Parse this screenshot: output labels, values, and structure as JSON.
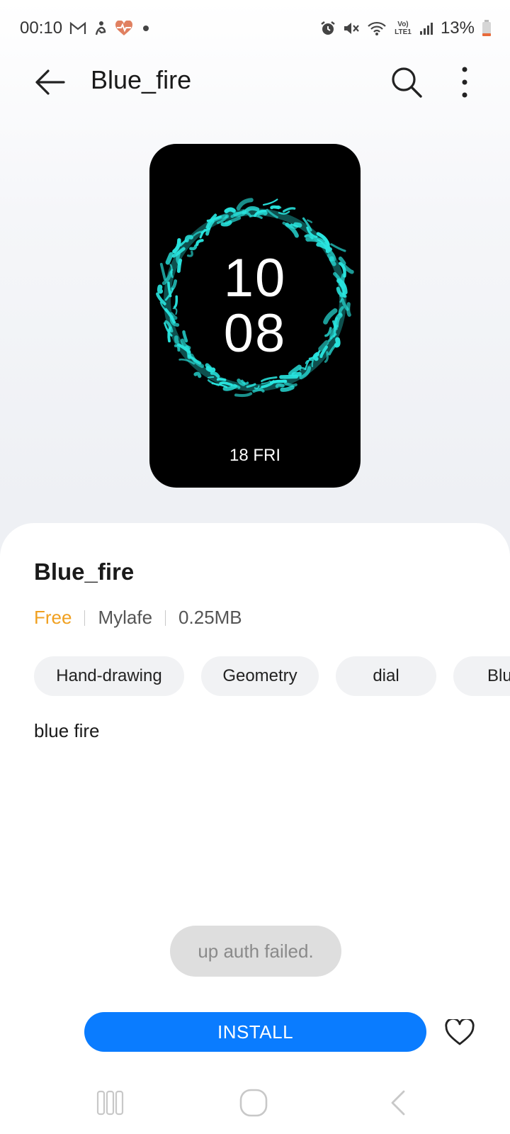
{
  "status_bar": {
    "time": "00:10",
    "battery": "13%",
    "network_label": "Vo) LTE1",
    "left_icons": [
      "gmail-icon",
      "activity-icon",
      "heart-rate-icon",
      "dot-icon"
    ],
    "right_icons": [
      "alarm-icon",
      "mute-icon",
      "wifi-icon",
      "volte-icon",
      "signal-icon",
      "battery-icon"
    ]
  },
  "app_bar": {
    "title": "Blue_fire",
    "icons": [
      "back-arrow-icon",
      "search-icon",
      "more-vert-icon"
    ]
  },
  "preview": {
    "hour": "10",
    "minute": "08",
    "date": "18 FRI",
    "ring_color": "#29e6e0"
  },
  "details": {
    "title": "Blue_fire",
    "price": "Free",
    "author": "Mylafe",
    "size": "0.25MB",
    "price_color": "#f0a020",
    "tags": [
      "Hand-drawing",
      "Geometry",
      "dial",
      "Blu"
    ],
    "description": "blue fire"
  },
  "toast": {
    "message": "up auth failed."
  },
  "actions": {
    "install_label": "INSTALL",
    "install_color": "#0a7cff",
    "favorite_icon": "heart-outline-icon"
  },
  "nav_bar": {
    "icons": [
      "recents-icon",
      "home-icon",
      "back-icon"
    ]
  }
}
